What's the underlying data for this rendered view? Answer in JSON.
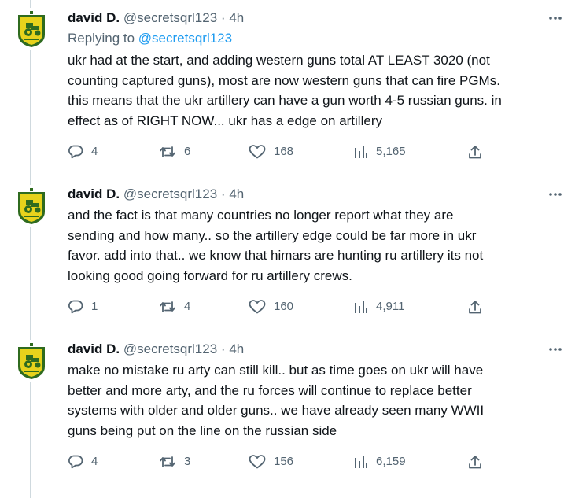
{
  "tweets": [
    {
      "name": "david D.",
      "handle": "@secretsqrl123",
      "dot": "·",
      "time": "4h",
      "replying_prefix": "Replying to ",
      "replying_handle": "@secretsqrl123",
      "lines": [
        "ukr had at the start, and adding western guns total AT LEAST 3020 (not",
        "counting captured guns), most are now western guns that can fire PGMs.",
        "this means that the ukr artillery can have a gun worth 4-5 russian guns.  in",
        "effect as of RIGHT NOW... ukr has a edge on artillery"
      ],
      "replies": "4",
      "retweets": "6",
      "likes": "168",
      "views": "5,165"
    },
    {
      "name": "david D.",
      "handle": "@secretsqrl123",
      "dot": "·",
      "time": "4h",
      "lines": [
        "and the fact is that many countries no longer report what they are",
        "sending and how many.. so the artillery edge could be far more in ukr",
        "favor.  add into that.. we know that himars are hunting ru artillery its not",
        "looking good going forward for ru artillery crews."
      ],
      "replies": "1",
      "retweets": "4",
      "likes": "160",
      "views": "4,911"
    },
    {
      "name": "david D.",
      "handle": "@secretsqrl123",
      "dot": "·",
      "time": "4h",
      "lines": [
        "make no mistake ru arty can still kill.. but as time goes on ukr will have",
        "better and more arty, and the ru forces will continue to replace better",
        "systems with older and older guns.. we have already seen many WWII",
        "guns being put on the line on the russian side"
      ],
      "replies": "4",
      "retweets": "3",
      "likes": "156",
      "views": "6,159"
    }
  ],
  "icons": {
    "more": "more-horizontal-icon",
    "reply": "reply-bubble-icon",
    "retweet": "retweet-icon",
    "like": "heart-icon",
    "views": "views-bar-chart-icon",
    "share": "share-upload-icon"
  },
  "colors": {
    "text": "#0f1419",
    "secondary": "#536471",
    "link": "#1d9bf0",
    "thread_line": "#cfd9de",
    "avatar_green": "#2f6b1f",
    "avatar_yellow": "#e7d21c"
  }
}
